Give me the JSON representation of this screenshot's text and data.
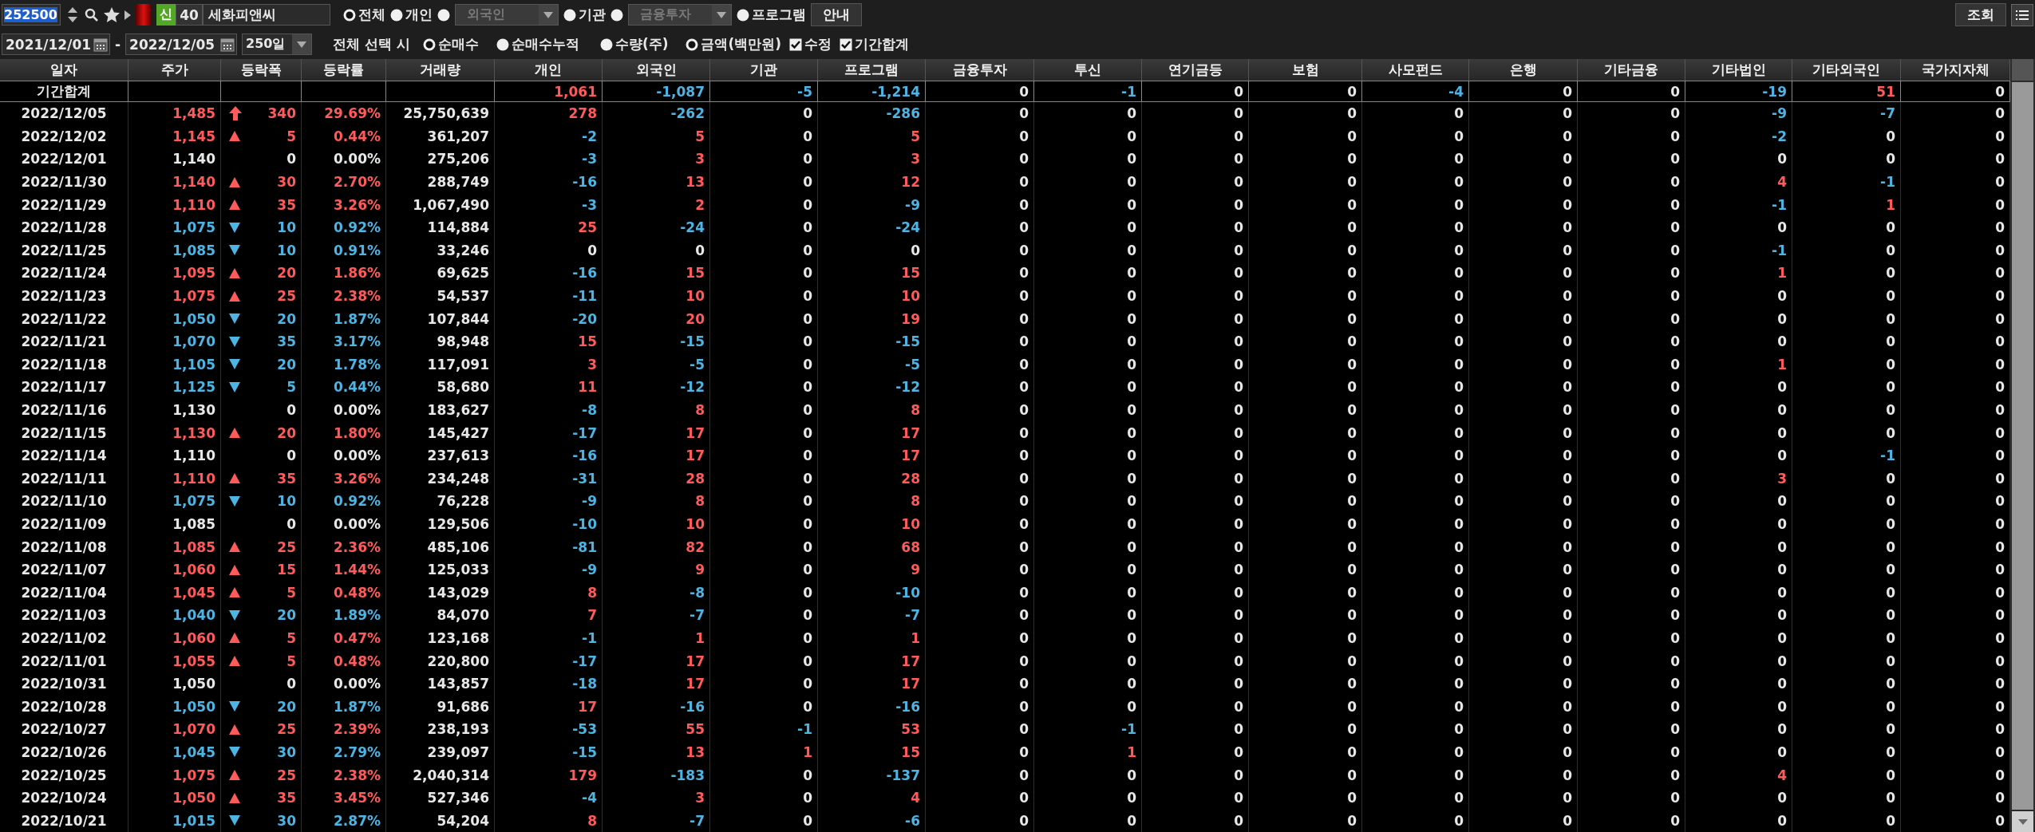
{
  "toolbar": {
    "stock_code": {
      "value": "252500",
      "highlighted": true
    },
    "listing_badge": "신",
    "count": "40",
    "stock_name": "세화피앤씨",
    "investor_options": [
      {
        "kind": "radio",
        "label": "전체",
        "selected": true
      },
      {
        "kind": "radio",
        "label": "개인",
        "selected": false
      },
      {
        "kind": "dropdown",
        "label": "외국인",
        "selected": false,
        "disabled": true
      },
      {
        "kind": "radio",
        "label": "기관",
        "selected": false
      },
      {
        "kind": "dropdown",
        "label": "금융투자",
        "selected": false,
        "disabled": true
      },
      {
        "kind": "radio",
        "label": "프로그램",
        "selected": false
      }
    ],
    "guide_button": "안내",
    "search_button": "조회"
  },
  "filter_bar": {
    "date_from": "2021/12/01",
    "date_separator": "-",
    "date_to": "2022/12/05",
    "period": "250일",
    "select_all_label": "전체 선택 시",
    "mode_options": [
      {
        "label": "순매수",
        "selected": true
      },
      {
        "label": "순매수누적",
        "selected": false
      }
    ],
    "unit_options": [
      {
        "label": "수량(주)",
        "selected": false
      },
      {
        "label": "금액(백만원)",
        "selected": true
      }
    ],
    "checkboxes": [
      {
        "label": "수정",
        "checked": true
      },
      {
        "label": "기간합계",
        "checked": true
      }
    ]
  },
  "table": {
    "columns": [
      "일자",
      "주가",
      "등락폭",
      "등락률",
      "거래량",
      "개인",
      "외국인",
      "기관",
      "프로그램",
      "금융투자",
      "투신",
      "연기금등",
      "보험",
      "사모펀드",
      "은행",
      "기타금융",
      "기타법인",
      "기타외국인",
      "국가지자체"
    ],
    "summary": {
      "label": "기간합계",
      "flows": [
        "1,061",
        "-1,087",
        "-5",
        "-1,214",
        "0",
        "-1",
        "0",
        "0",
        "-4",
        "0",
        "0",
        "-19",
        "51",
        "0"
      ]
    },
    "rows": [
      {
        "date": "2022/12/05",
        "price": "1,485",
        "kind": "surge",
        "change": "340",
        "rate": "29.69%",
        "volume": "25,750,639",
        "flows": [
          "278",
          "-262",
          "0",
          "-286",
          "0",
          "0",
          "0",
          "0",
          "0",
          "0",
          "0",
          "-9",
          "-7",
          "0"
        ]
      },
      {
        "date": "2022/12/02",
        "price": "1,145",
        "kind": "up",
        "change": "5",
        "rate": "0.44%",
        "volume": "361,207",
        "flows": [
          "-2",
          "5",
          "0",
          "5",
          "0",
          "0",
          "0",
          "0",
          "0",
          "0",
          "0",
          "-2",
          "0",
          "0"
        ]
      },
      {
        "date": "2022/12/01",
        "price": "1,140",
        "kind": "flat",
        "change": "0",
        "rate": "0.00%",
        "volume": "275,206",
        "flows": [
          "-3",
          "3",
          "0",
          "3",
          "0",
          "0",
          "0",
          "0",
          "0",
          "0",
          "0",
          "0",
          "0",
          "0"
        ]
      },
      {
        "date": "2022/11/30",
        "price": "1,140",
        "kind": "up",
        "change": "30",
        "rate": "2.70%",
        "volume": "288,749",
        "flows": [
          "-16",
          "13",
          "0",
          "12",
          "0",
          "0",
          "0",
          "0",
          "0",
          "0",
          "0",
          "4",
          "-1",
          "0"
        ]
      },
      {
        "date": "2022/11/29",
        "price": "1,110",
        "kind": "up",
        "change": "35",
        "rate": "3.26%",
        "volume": "1,067,490",
        "flows": [
          "-3",
          "2",
          "0",
          "-9",
          "0",
          "0",
          "0",
          "0",
          "0",
          "0",
          "0",
          "-1",
          "1",
          "0"
        ]
      },
      {
        "date": "2022/11/28",
        "price": "1,075",
        "kind": "down",
        "change": "10",
        "rate": "0.92%",
        "volume": "114,884",
        "flows": [
          "25",
          "-24",
          "0",
          "-24",
          "0",
          "0",
          "0",
          "0",
          "0",
          "0",
          "0",
          "0",
          "0",
          "0"
        ]
      },
      {
        "date": "2022/11/25",
        "price": "1,085",
        "kind": "down",
        "change": "10",
        "rate": "0.91%",
        "volume": "33,246",
        "flows": [
          "0",
          "0",
          "0",
          "0",
          "0",
          "0",
          "0",
          "0",
          "0",
          "0",
          "0",
          "-1",
          "0",
          "0"
        ]
      },
      {
        "date": "2022/11/24",
        "price": "1,095",
        "kind": "up",
        "change": "20",
        "rate": "1.86%",
        "volume": "69,625",
        "flows": [
          "-16",
          "15",
          "0",
          "15",
          "0",
          "0",
          "0",
          "0",
          "0",
          "0",
          "0",
          "1",
          "0",
          "0"
        ]
      },
      {
        "date": "2022/11/23",
        "price": "1,075",
        "kind": "up",
        "change": "25",
        "rate": "2.38%",
        "volume": "54,537",
        "flows": [
          "-11",
          "10",
          "0",
          "10",
          "0",
          "0",
          "0",
          "0",
          "0",
          "0",
          "0",
          "0",
          "0",
          "0"
        ]
      },
      {
        "date": "2022/11/22",
        "price": "1,050",
        "kind": "down",
        "change": "20",
        "rate": "1.87%",
        "volume": "107,844",
        "flows": [
          "-20",
          "20",
          "0",
          "19",
          "0",
          "0",
          "0",
          "0",
          "0",
          "0",
          "0",
          "0",
          "0",
          "0"
        ]
      },
      {
        "date": "2022/11/21",
        "price": "1,070",
        "kind": "down",
        "change": "35",
        "rate": "3.17%",
        "volume": "98,948",
        "flows": [
          "15",
          "-15",
          "0",
          "-15",
          "0",
          "0",
          "0",
          "0",
          "0",
          "0",
          "0",
          "0",
          "0",
          "0"
        ]
      },
      {
        "date": "2022/11/18",
        "price": "1,105",
        "kind": "down",
        "change": "20",
        "rate": "1.78%",
        "volume": "117,091",
        "flows": [
          "3",
          "-5",
          "0",
          "-5",
          "0",
          "0",
          "0",
          "0",
          "0",
          "0",
          "0",
          "1",
          "0",
          "0"
        ]
      },
      {
        "date": "2022/11/17",
        "price": "1,125",
        "kind": "down",
        "change": "5",
        "rate": "0.44%",
        "volume": "58,680",
        "flows": [
          "11",
          "-12",
          "0",
          "-12",
          "0",
          "0",
          "0",
          "0",
          "0",
          "0",
          "0",
          "0",
          "0",
          "0"
        ]
      },
      {
        "date": "2022/11/16",
        "price": "1,130",
        "kind": "flat",
        "change": "0",
        "rate": "0.00%",
        "volume": "183,627",
        "flows": [
          "-8",
          "8",
          "0",
          "8",
          "0",
          "0",
          "0",
          "0",
          "0",
          "0",
          "0",
          "0",
          "0",
          "0"
        ]
      },
      {
        "date": "2022/11/15",
        "price": "1,130",
        "kind": "up",
        "change": "20",
        "rate": "1.80%",
        "volume": "145,427",
        "flows": [
          "-17",
          "17",
          "0",
          "17",
          "0",
          "0",
          "0",
          "0",
          "0",
          "0",
          "0",
          "0",
          "0",
          "0"
        ]
      },
      {
        "date": "2022/11/14",
        "price": "1,110",
        "kind": "flat",
        "change": "0",
        "rate": "0.00%",
        "volume": "237,613",
        "flows": [
          "-16",
          "17",
          "0",
          "17",
          "0",
          "0",
          "0",
          "0",
          "0",
          "0",
          "0",
          "0",
          "-1",
          "0"
        ]
      },
      {
        "date": "2022/11/11",
        "price": "1,110",
        "kind": "up",
        "change": "35",
        "rate": "3.26%",
        "volume": "234,248",
        "flows": [
          "-31",
          "28",
          "0",
          "28",
          "0",
          "0",
          "0",
          "0",
          "0",
          "0",
          "0",
          "3",
          "0",
          "0"
        ]
      },
      {
        "date": "2022/11/10",
        "price": "1,075",
        "kind": "down",
        "change": "10",
        "rate": "0.92%",
        "volume": "76,228",
        "flows": [
          "-9",
          "8",
          "0",
          "8",
          "0",
          "0",
          "0",
          "0",
          "0",
          "0",
          "0",
          "0",
          "0",
          "0"
        ]
      },
      {
        "date": "2022/11/09",
        "price": "1,085",
        "kind": "flat",
        "change": "0",
        "rate": "0.00%",
        "volume": "129,506",
        "flows": [
          "-10",
          "10",
          "0",
          "10",
          "0",
          "0",
          "0",
          "0",
          "0",
          "0",
          "0",
          "0",
          "0",
          "0"
        ]
      },
      {
        "date": "2022/11/08",
        "price": "1,085",
        "kind": "up",
        "change": "25",
        "rate": "2.36%",
        "volume": "485,106",
        "flows": [
          "-81",
          "82",
          "0",
          "68",
          "0",
          "0",
          "0",
          "0",
          "0",
          "0",
          "0",
          "0",
          "0",
          "0"
        ]
      },
      {
        "date": "2022/11/07",
        "price": "1,060",
        "kind": "up",
        "change": "15",
        "rate": "1.44%",
        "volume": "125,033",
        "flows": [
          "-9",
          "9",
          "0",
          "9",
          "0",
          "0",
          "0",
          "0",
          "0",
          "0",
          "0",
          "0",
          "0",
          "0"
        ]
      },
      {
        "date": "2022/11/04",
        "price": "1,045",
        "kind": "up",
        "change": "5",
        "rate": "0.48%",
        "volume": "143,029",
        "flows": [
          "8",
          "-8",
          "0",
          "-10",
          "0",
          "0",
          "0",
          "0",
          "0",
          "0",
          "0",
          "0",
          "0",
          "0"
        ]
      },
      {
        "date": "2022/11/03",
        "price": "1,040",
        "kind": "down",
        "change": "20",
        "rate": "1.89%",
        "volume": "84,070",
        "flows": [
          "7",
          "-7",
          "0",
          "-7",
          "0",
          "0",
          "0",
          "0",
          "0",
          "0",
          "0",
          "0",
          "0",
          "0"
        ]
      },
      {
        "date": "2022/11/02",
        "price": "1,060",
        "kind": "up",
        "change": "5",
        "rate": "0.47%",
        "volume": "123,168",
        "flows": [
          "-1",
          "1",
          "0",
          "1",
          "0",
          "0",
          "0",
          "0",
          "0",
          "0",
          "0",
          "0",
          "0",
          "0"
        ]
      },
      {
        "date": "2022/11/01",
        "price": "1,055",
        "kind": "up",
        "change": "5",
        "rate": "0.48%",
        "volume": "220,800",
        "flows": [
          "-17",
          "17",
          "0",
          "17",
          "0",
          "0",
          "0",
          "0",
          "0",
          "0",
          "0",
          "0",
          "0",
          "0"
        ]
      },
      {
        "date": "2022/10/31",
        "price": "1,050",
        "kind": "flat",
        "change": "0",
        "rate": "0.00%",
        "volume": "143,857",
        "flows": [
          "-18",
          "17",
          "0",
          "17",
          "0",
          "0",
          "0",
          "0",
          "0",
          "0",
          "0",
          "0",
          "0",
          "0"
        ]
      },
      {
        "date": "2022/10/28",
        "price": "1,050",
        "kind": "down",
        "change": "20",
        "rate": "1.87%",
        "volume": "91,686",
        "flows": [
          "17",
          "-16",
          "0",
          "-16",
          "0",
          "0",
          "0",
          "0",
          "0",
          "0",
          "0",
          "0",
          "0",
          "0"
        ]
      },
      {
        "date": "2022/10/27",
        "price": "1,070",
        "kind": "up",
        "change": "25",
        "rate": "2.39%",
        "volume": "238,193",
        "flows": [
          "-53",
          "55",
          "-1",
          "53",
          "0",
          "-1",
          "0",
          "0",
          "0",
          "0",
          "0",
          "0",
          "0",
          "0"
        ]
      },
      {
        "date": "2022/10/26",
        "price": "1,045",
        "kind": "down",
        "change": "30",
        "rate": "2.79%",
        "volume": "239,097",
        "flows": [
          "-15",
          "13",
          "1",
          "15",
          "0",
          "1",
          "0",
          "0",
          "0",
          "0",
          "0",
          "0",
          "0",
          "0"
        ]
      },
      {
        "date": "2022/10/25",
        "price": "1,075",
        "kind": "up",
        "change": "25",
        "rate": "2.38%",
        "volume": "2,040,314",
        "flows": [
          "179",
          "-183",
          "0",
          "-137",
          "0",
          "0",
          "0",
          "0",
          "0",
          "0",
          "0",
          "4",
          "0",
          "0"
        ]
      },
      {
        "date": "2022/10/24",
        "price": "1,050",
        "kind": "up",
        "change": "35",
        "rate": "3.45%",
        "volume": "527,346",
        "flows": [
          "-4",
          "3",
          "0",
          "4",
          "0",
          "0",
          "0",
          "0",
          "0",
          "0",
          "0",
          "0",
          "0",
          "0"
        ]
      },
      {
        "date": "2022/10/21",
        "price": "1,015",
        "kind": "down",
        "change": "30",
        "rate": "2.87%",
        "volume": "54,204",
        "flows": [
          "8",
          "-7",
          "0",
          "-6",
          "0",
          "0",
          "0",
          "0",
          "0",
          "0",
          "0",
          "0",
          "0",
          "0"
        ]
      }
    ]
  }
}
